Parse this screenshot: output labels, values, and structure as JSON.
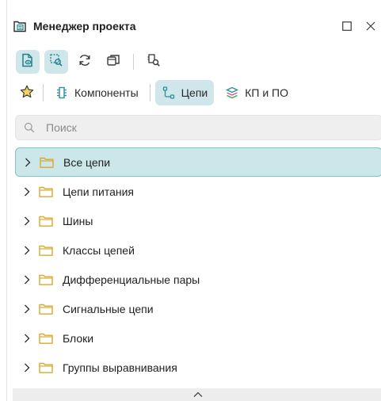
{
  "window": {
    "title": "Менеджер проекта",
    "title_icon": "project-manager-icon",
    "actions": [
      {
        "name": "maximize-icon"
      },
      {
        "name": "close-icon"
      }
    ]
  },
  "toolbar": {
    "buttons": [
      {
        "name": "document-view-icon",
        "active": true
      },
      {
        "name": "zoom-to-selection-icon",
        "active": true
      },
      {
        "name": "refresh-icon",
        "active": false
      },
      {
        "name": "copy-window-icon",
        "active": false
      },
      {
        "name": "find-component-icon",
        "active": false
      }
    ]
  },
  "tabs": {
    "favorites_icon": "star-icon",
    "items": [
      {
        "label": "Компоненты",
        "icon": "component-icon",
        "active": false
      },
      {
        "label": "Цепи",
        "icon": "net-icon",
        "active": true
      },
      {
        "label": "КП и ПО",
        "icon": "layers-icon",
        "active": false
      }
    ]
  },
  "search": {
    "placeholder": "Поиск",
    "value": ""
  },
  "tree": {
    "items": [
      {
        "label": "Все цепи",
        "selected": true
      },
      {
        "label": "Цепи питания",
        "selected": false
      },
      {
        "label": "Шины",
        "selected": false
      },
      {
        "label": "Классы цепей",
        "selected": false
      },
      {
        "label": "Дифференциальные пары",
        "selected": false
      },
      {
        "label": "Сигнальные цепи",
        "selected": false
      },
      {
        "label": "Блоки",
        "selected": false
      },
      {
        "label": "Группы выравнивания",
        "selected": false
      }
    ]
  },
  "colors": {
    "accent_bg": "#cfe7ea",
    "accent_border": "#7dc3c9",
    "icon_teal": "#2a8f99",
    "folder_yellow": "#d9a92e"
  }
}
